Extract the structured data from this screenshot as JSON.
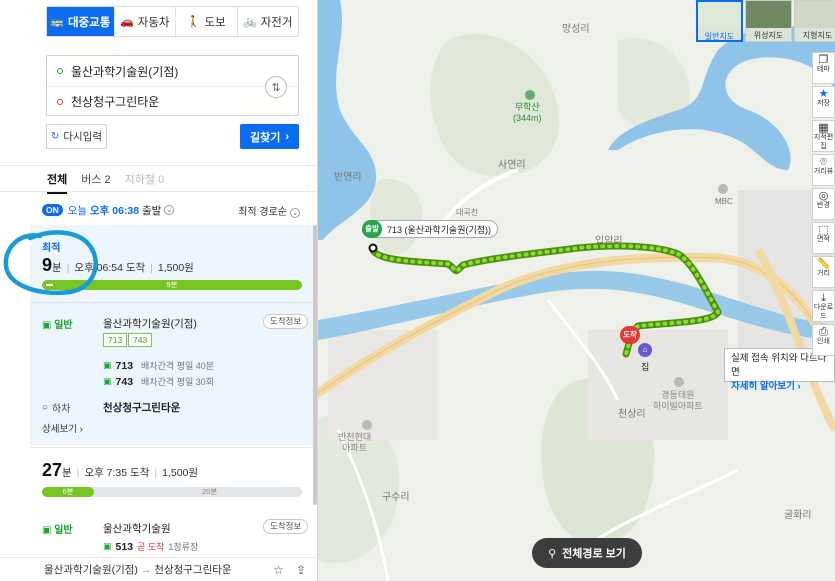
{
  "modes": [
    {
      "label": "대중교통",
      "icon": "bus-icon",
      "glyph": "🚌"
    },
    {
      "label": "자동차",
      "icon": "car-icon",
      "glyph": "🚗"
    },
    {
      "label": "도보",
      "icon": "walk-icon",
      "glyph": "🚶"
    },
    {
      "label": "자전거",
      "icon": "bike-icon",
      "glyph": "🚲"
    }
  ],
  "route": {
    "origin": "울산과학기술원(기점)",
    "destination": "천상청구그린타운"
  },
  "buttons": {
    "reset": "다시입력",
    "find": "길찾기"
  },
  "tabs": [
    {
      "label": "전체"
    },
    {
      "label": "버스 2"
    },
    {
      "label": "지하철 0"
    }
  ],
  "depart": {
    "on": "ON",
    "day": "오늘",
    "time": "오후 06:38",
    "suffix": "출발",
    "sort": "최적 경로순"
  },
  "result1": {
    "tag": "최적",
    "minutes": "9",
    "min_unit": "분",
    "arrive": "오후 06:54 도착",
    "fare": "1,500원",
    "bar_label": "9분",
    "board_label": "일반",
    "board_stop": "울산과학기술원(기점)",
    "arrival_info": "도착정보",
    "bus_chips": [
      "713",
      "743"
    ],
    "buses": [
      {
        "no": "713",
        "desc": "배차간격 평일 40분"
      },
      {
        "no": "743",
        "desc": "배차간격 평일 30회"
      }
    ],
    "off_label": "하차",
    "off_stop": "천상청구그린타운",
    "more": "상세보기"
  },
  "result2": {
    "minutes": "27",
    "min_unit": "분",
    "arrive": "오후 7:35 도착",
    "fare": "1,500원",
    "bar_walk": "6분",
    "bar_rest": "20분",
    "board_label": "일반",
    "board_stop": "울산과학기술원",
    "arrival_info": "도착정보",
    "bus_no": "513",
    "bus_status": "곧 도착",
    "bus_sub": "1정류장"
  },
  "footer": {
    "origin": "울산과학기술원(기점)",
    "arrow": "→",
    "destination": "천상청구그린타운"
  },
  "map": {
    "maptypes": [
      "일반지도",
      "위성지도",
      "지형지도"
    ],
    "labels": [
      "망성리",
      "사연리",
      "반연리",
      "대곡천",
      "입암리",
      "천상리",
      "구수리",
      "굴화리",
      "MBC"
    ],
    "mountain": [
      "무학산",
      "(344m)"
    ],
    "apt1": [
      "경동테원",
      "하이빌아파트"
    ],
    "apt2": [
      "반천현대",
      "아파트"
    ],
    "home": "집",
    "start_tag": "출발",
    "start_label": "713 (울산과학기술원(기점))",
    "end_tag": "도착",
    "tip_text": "실제 접속 위치와 다르다면",
    "tip_link": "자세히 알아보기",
    "full_route": "전체경로 보기",
    "tools": [
      "테마",
      "저장",
      "지적편집",
      "거리뷰",
      "반경",
      "면적",
      "거리",
      "다운로드",
      "인쇄"
    ]
  }
}
